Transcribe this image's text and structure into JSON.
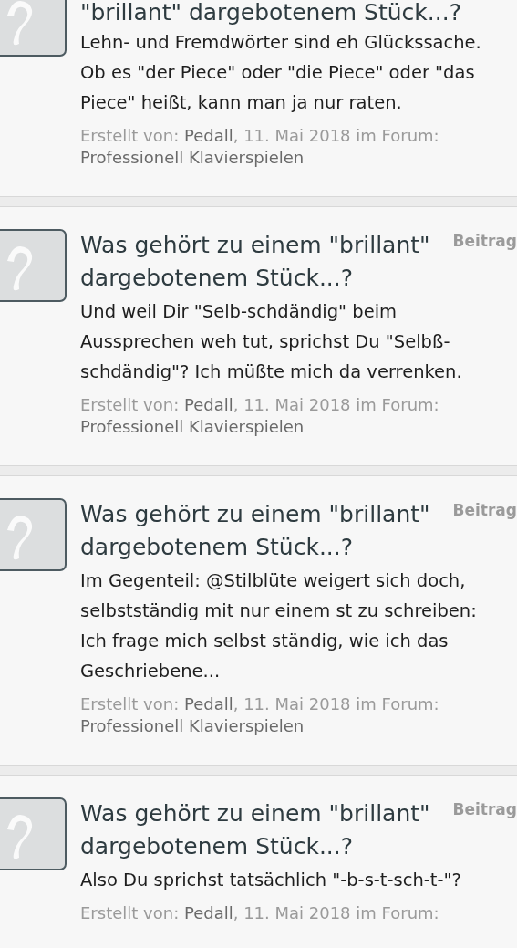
{
  "results": [
    {
      "kind": "partial",
      "title": "\"brillant\" dargebotenem Stück...?",
      "body": "Lehn- und Fremdwörter sind eh Glückssache. Ob es \"der Piece\" oder \"die Piece\" oder \"das Piece\" heißt, kann man ja nur raten.",
      "meta": {
        "prefix": "Erstellt von:",
        "author": "Pedall",
        "date": ", 11. Mai 2018 im Forum:",
        "forum": "Professionell Klavierspielen"
      }
    },
    {
      "kind": "full",
      "type_label": "Beitrag",
      "title": "Was gehört zu einem \"brillant\" dargebotenem Stück...?",
      "body": "Und weil Dir \"Selb-schdändig\" beim Aussprechen weh tut, sprichst Du \"Selbß-schdändig\"? Ich müßte mich da verrenken.",
      "meta": {
        "prefix": "Erstellt von:",
        "author": "Pedall",
        "date": ", 11. Mai 2018 im Forum:",
        "forum": "Professionell Klavierspielen"
      }
    },
    {
      "kind": "full",
      "type_label": "Beitrag",
      "title": "Was gehört zu einem \"brillant\" dargebotenem Stück...?",
      "body": "Im Gegenteil: @Stilblüte weigert sich doch, selbstständig mit nur einem st zu schreiben: Ich frage mich selbst ständig, wie ich das Geschriebene...",
      "meta": {
        "prefix": "Erstellt von:",
        "author": "Pedall",
        "date": ", 11. Mai 2018 im Forum:",
        "forum": "Professionell Klavierspielen"
      }
    },
    {
      "kind": "full",
      "type_label": "Beitrag",
      "title": "Was gehört zu einem \"brillant\" dargebotenem Stück...?",
      "body": "Also Du sprichst tatsächlich \"-b-s-t-sch-t-\"?",
      "meta": {
        "prefix": "Erstellt von:",
        "author": "Pedall",
        "date": ", 11. Mai 2018 im Forum:"
      }
    }
  ]
}
